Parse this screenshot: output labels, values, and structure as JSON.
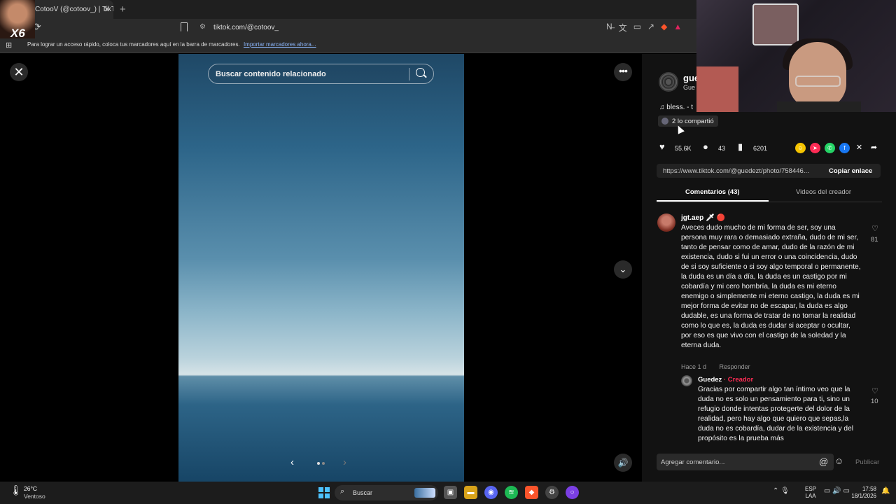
{
  "browser": {
    "tab_title": "CotooV (@cotoov_) | TikT",
    "tab_close": "✕",
    "new_tab": "+",
    "url": "tiktok.com/@cotoov_",
    "bookmarks_hint": "Para lograr un acceso rápido, coloca tus marcadores aquí en la barra de marcadores.",
    "import_link": "Importar marcadores ahora..."
  },
  "overlay": {
    "corner_label": "X6"
  },
  "viewer": {
    "search_placeholder": "Buscar contenido relacionado",
    "close": "✕",
    "more": "•••",
    "down": "⌄",
    "volume": "🔊",
    "prev": "‹",
    "next": "›",
    "slides_total": 2,
    "slide_current": 1
  },
  "post": {
    "author_name": "gue",
    "author_sub": "Gue",
    "music": "♫  bless. - t",
    "shared": "2 lo compartió",
    "likes": "55.6K",
    "comments": "43",
    "saves": "6201",
    "link": "https://www.tiktok.com/@guedezt/photo/758446...",
    "copy_label": "Copiar enlace"
  },
  "tabs": {
    "comments": "Comentarios (43)",
    "creator_videos": "Videos del creador"
  },
  "comment": {
    "user": "jgt.aep 🗡 🔴",
    "text": "Aveces dudo mucho de mi forma de ser, soy una persona muy rara o demasiado extraña, dudo de mi ser, tanto de pensar como de amar, dudo de la razón de mi existencia, dudo si fui un error o una coincidencia, dudo de si soy suficiente o si soy algo temporal o permanente, la duda es un día a día, la duda es un castigo por mi cobardía y mi cero hombría, la duda es mi eterno enemigo o simplemente mi eterno castigo, la duda es mi mejor forma de evitar no de escapar, la duda es algo dudable, es una forma de tratar de no tomar la realidad como lo que es, la duda es dudar si aceptar o ocultar, por eso es que vivo con el castigo de la soledad y la eterna duda.",
    "time": "Hace 1 d",
    "reply_label": "Responder",
    "likes": "81"
  },
  "reply": {
    "user": "Guedez",
    "creator_tag": " · Creador",
    "text": "Gracias por compartir algo tan íntimo veo que la duda no es solo un pensamiento para ti, sino un refugio donde intentas protegerte del dolor de la realidad, pero hay algo que quiero que sepas,la duda no es cobardía, dudar de la existencia y del propósito es la prueba más",
    "likes": "10"
  },
  "composer": {
    "placeholder": "Agregar comentario...",
    "at": "@",
    "emoji": "☺",
    "publish": "Publicar"
  },
  "taskbar": {
    "temp": "26°C",
    "condition": "Ventoso",
    "search": "Buscar",
    "lang_top": "ESP",
    "lang_bottom": "LAA",
    "time": "17:58",
    "date": "18/1/2026"
  },
  "colors": {
    "accent_red": "#fe2c55",
    "link_blue": "#8ab4f8",
    "panel_bg": "#121212"
  }
}
